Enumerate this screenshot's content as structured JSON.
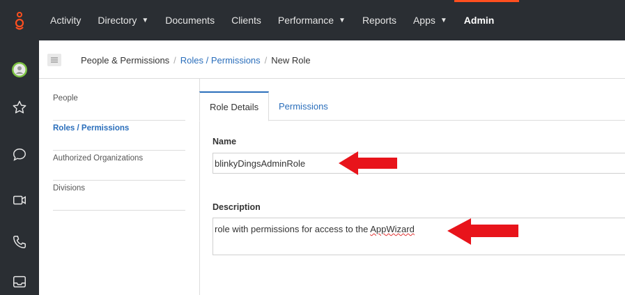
{
  "nav": {
    "items": [
      {
        "label": "Activity",
        "caret": false
      },
      {
        "label": "Directory",
        "caret": true
      },
      {
        "label": "Documents",
        "caret": false
      },
      {
        "label": "Clients",
        "caret": false
      },
      {
        "label": "Performance",
        "caret": true
      },
      {
        "label": "Reports",
        "caret": false
      },
      {
        "label": "Apps",
        "caret": true
      },
      {
        "label": "Admin",
        "caret": false,
        "active": true
      }
    ]
  },
  "breadcrumb": {
    "root": "People & Permissions",
    "link": "Roles / Permissions",
    "current": "New Role",
    "separator": "/"
  },
  "sidemenu": {
    "items": [
      "People",
      "Roles / Permissions",
      "Authorized Organizations",
      "Divisions"
    ]
  },
  "tabs": {
    "active": "Role Details",
    "other": "Permissions"
  },
  "form": {
    "name_label": "Name",
    "name_value": "blinkyDingsAdminRole",
    "description_label": "Description",
    "description_value_prefix": "role with permissions for access to the ",
    "description_value_misspelled": "AppWizard"
  },
  "colors": {
    "nav_bg": "#2a2e33",
    "accent_orange": "#ff4f1f",
    "link_blue": "#2a6ebb",
    "annotation_red": "#e8141b"
  },
  "icons": [
    "genesys-logo-icon",
    "avatar-status-icon",
    "star-icon",
    "chat-icon",
    "video-icon",
    "phone-icon",
    "inbox-icon",
    "hamburger-icon"
  ]
}
